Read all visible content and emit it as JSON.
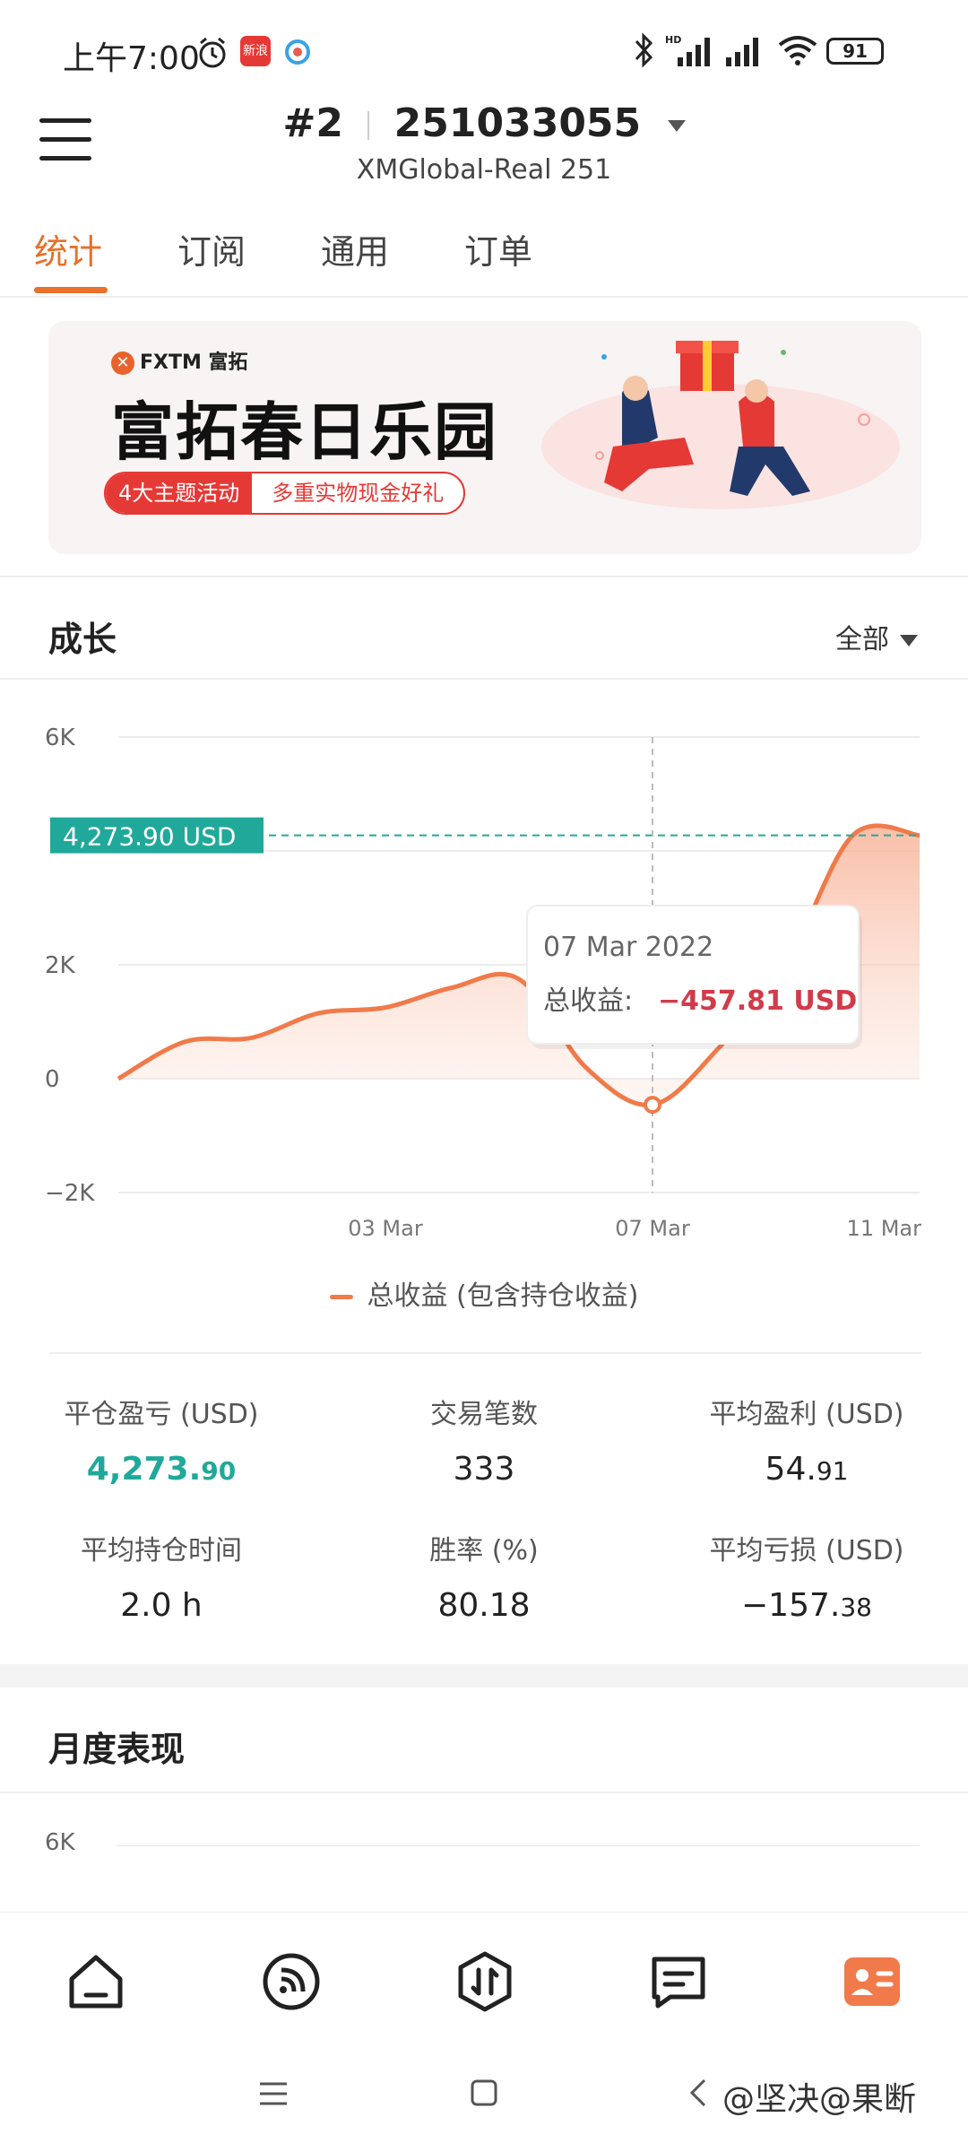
{
  "status_bar": {
    "time": "上午7:00",
    "battery": "91",
    "app_badge": "新浪"
  },
  "header": {
    "account_num": "#2",
    "account_id": "251033055",
    "server": "XMGlobal-Real 251"
  },
  "tabs": [
    {
      "label": "统计"
    },
    {
      "label": "订阅"
    },
    {
      "label": "通用"
    },
    {
      "label": "订单"
    }
  ],
  "banner": {
    "brand": "FXTM 富拓",
    "title": "富拓春日乐园",
    "pill_left": "4大主题活动",
    "pill_right": "多重实物现金好礼"
  },
  "growth": {
    "title": "成长",
    "filter": "全部"
  },
  "chart_data": {
    "type": "area",
    "x_ticks": [
      "03 Mar",
      "07 Mar",
      "11 Mar"
    ],
    "y_ticks": [
      "6K",
      "2K",
      "0",
      "−2K"
    ],
    "ylim": [
      -2000,
      6000
    ],
    "series": [
      {
        "name": "总收益 (包含持仓收益)",
        "x": [
          "27 Feb",
          "28 Feb",
          "01 Mar",
          "02 Mar",
          "03 Mar",
          "04 Mar",
          "05 Mar",
          "06 Mar",
          "07 Mar",
          "08 Mar",
          "09 Mar",
          "10 Mar",
          "11 Mar"
        ],
        "values": [
          0,
          650,
          720,
          1150,
          1250,
          1600,
          1750,
          200,
          -457.81,
          550,
          2000,
          4273.9,
          4273.9
        ]
      }
    ],
    "current_label": "4,273.90 USD",
    "tooltip": {
      "date": "07 Mar 2022",
      "label": "总收益:",
      "value": "−457.81 USD"
    },
    "legend": "总收益 (包含持仓收益)"
  },
  "stats": [
    {
      "label": "平仓盈亏 (USD)",
      "int": "4,273.",
      "dec": "90"
    },
    {
      "label": "交易笔数",
      "int": "333",
      "dec": ""
    },
    {
      "label": "平均盈利 (USD)",
      "int": "54.",
      "dec": "91"
    },
    {
      "label": "平均持仓时间",
      "int": "2.0 h",
      "dec": ""
    },
    {
      "label": "胜率 (%)",
      "int": "80.18",
      "dec": ""
    },
    {
      "label": "平均亏损 (USD)",
      "int": "−157.",
      "dec": "38"
    }
  ],
  "monthly": {
    "title": "月度表现",
    "y_top": "6K"
  },
  "watermark": "@坚决@果断",
  "colors": {
    "accent": "#e86f2c",
    "green": "#20a99a",
    "red": "#d23b4a",
    "line": "#f07a4a"
  }
}
